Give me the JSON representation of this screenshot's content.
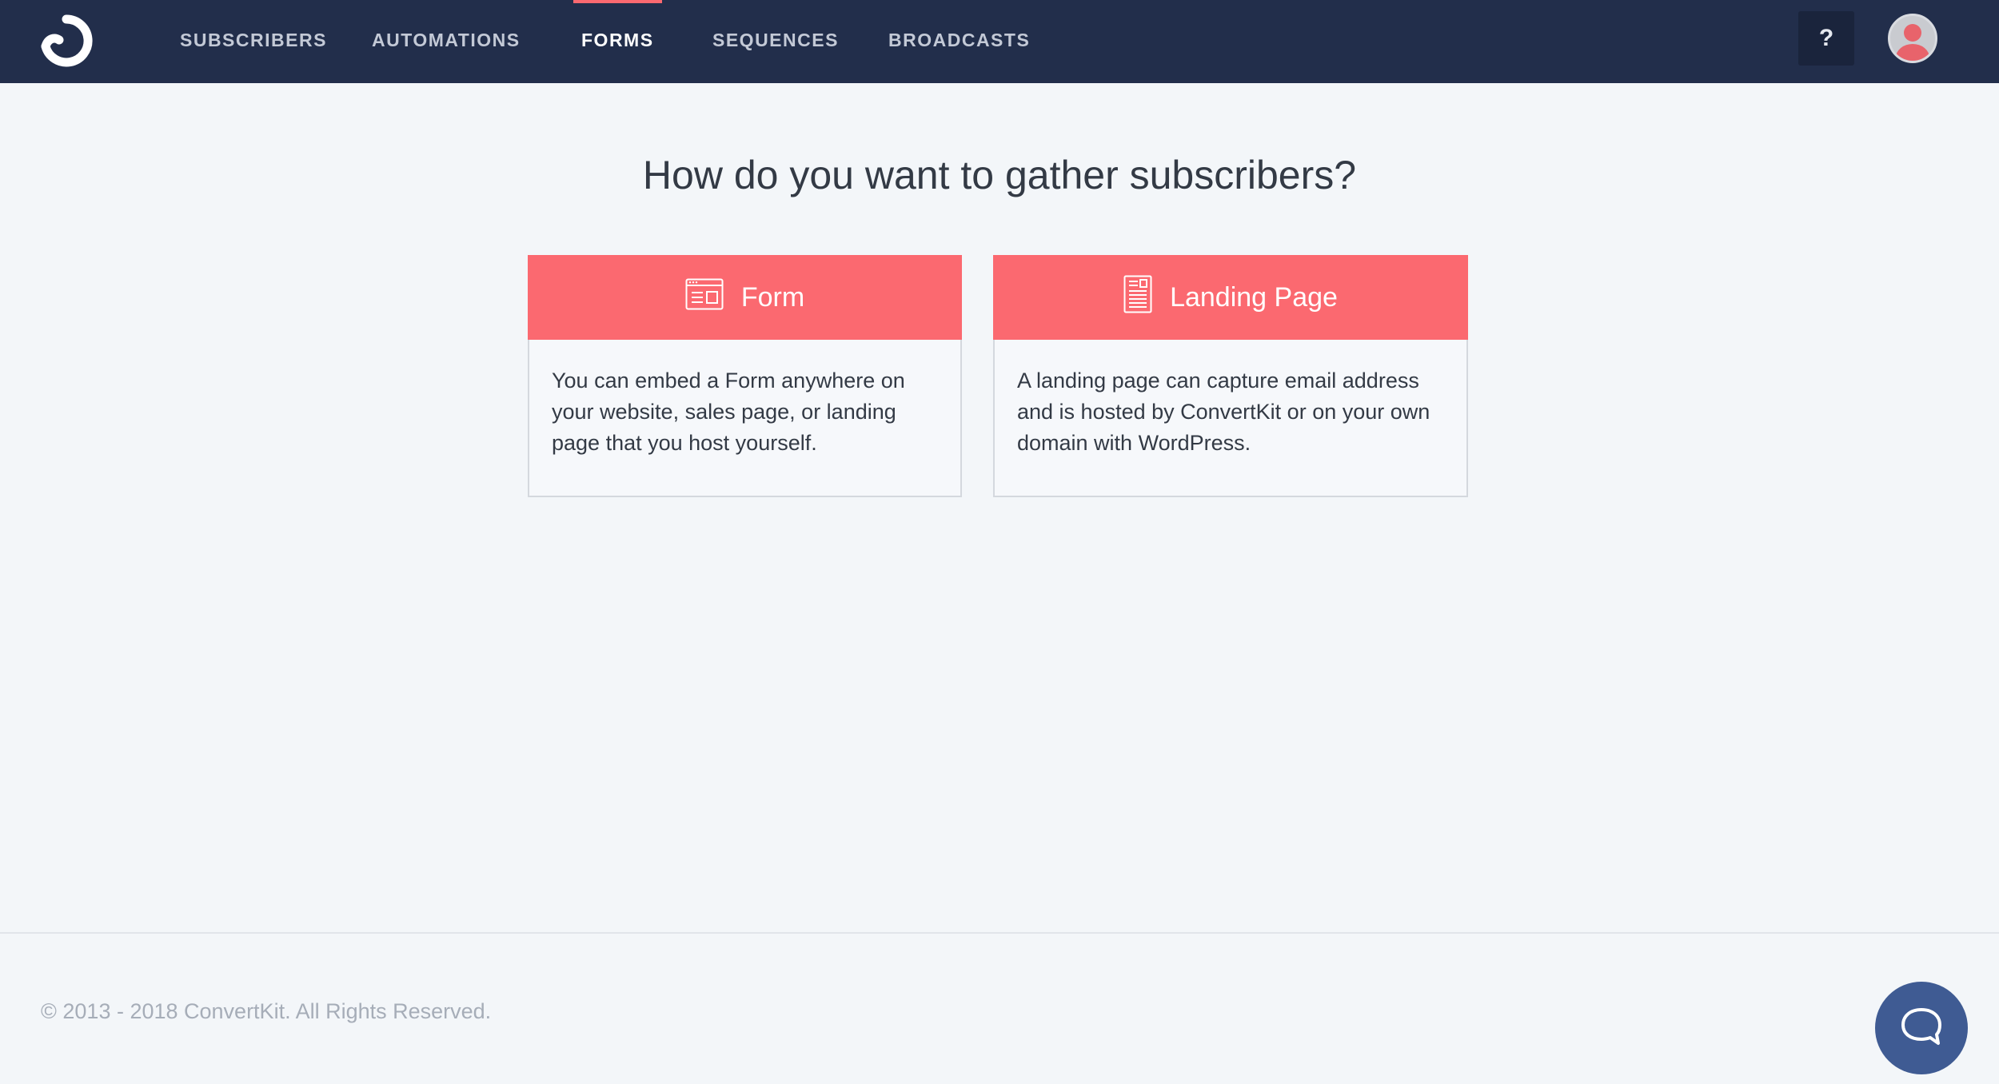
{
  "colors": {
    "topbar": "#222e4b",
    "accent": "#fb6970",
    "background": "#f3f6f9",
    "chat": "#3f5b93"
  },
  "nav": {
    "items": [
      {
        "label": "SUBSCRIBERS",
        "active": false
      },
      {
        "label": "AUTOMATIONS",
        "active": false
      },
      {
        "label": "FORMS",
        "active": true
      },
      {
        "label": "SEQUENCES",
        "active": false
      },
      {
        "label": "BROADCASTS",
        "active": false
      }
    ],
    "help_label": "?",
    "logo_icon": "convertkit-logo-icon",
    "avatar_icon": "user-avatar-icon"
  },
  "main": {
    "headline": "How do you want to gather subscribers?",
    "cards": [
      {
        "title": "Form",
        "icon": "form-icon",
        "description": "You can embed a Form anywhere on your website, sales page, or landing page that you host yourself."
      },
      {
        "title": "Landing Page",
        "icon": "landing-page-icon",
        "description": "A landing page can capture email address and is hosted by ConvertKit or on your own domain with WordPress."
      }
    ]
  },
  "footer": {
    "copyright": "© 2013 - 2018 ConvertKit. All Rights Reserved.",
    "chat_icon": "chat-bubble-icon"
  }
}
